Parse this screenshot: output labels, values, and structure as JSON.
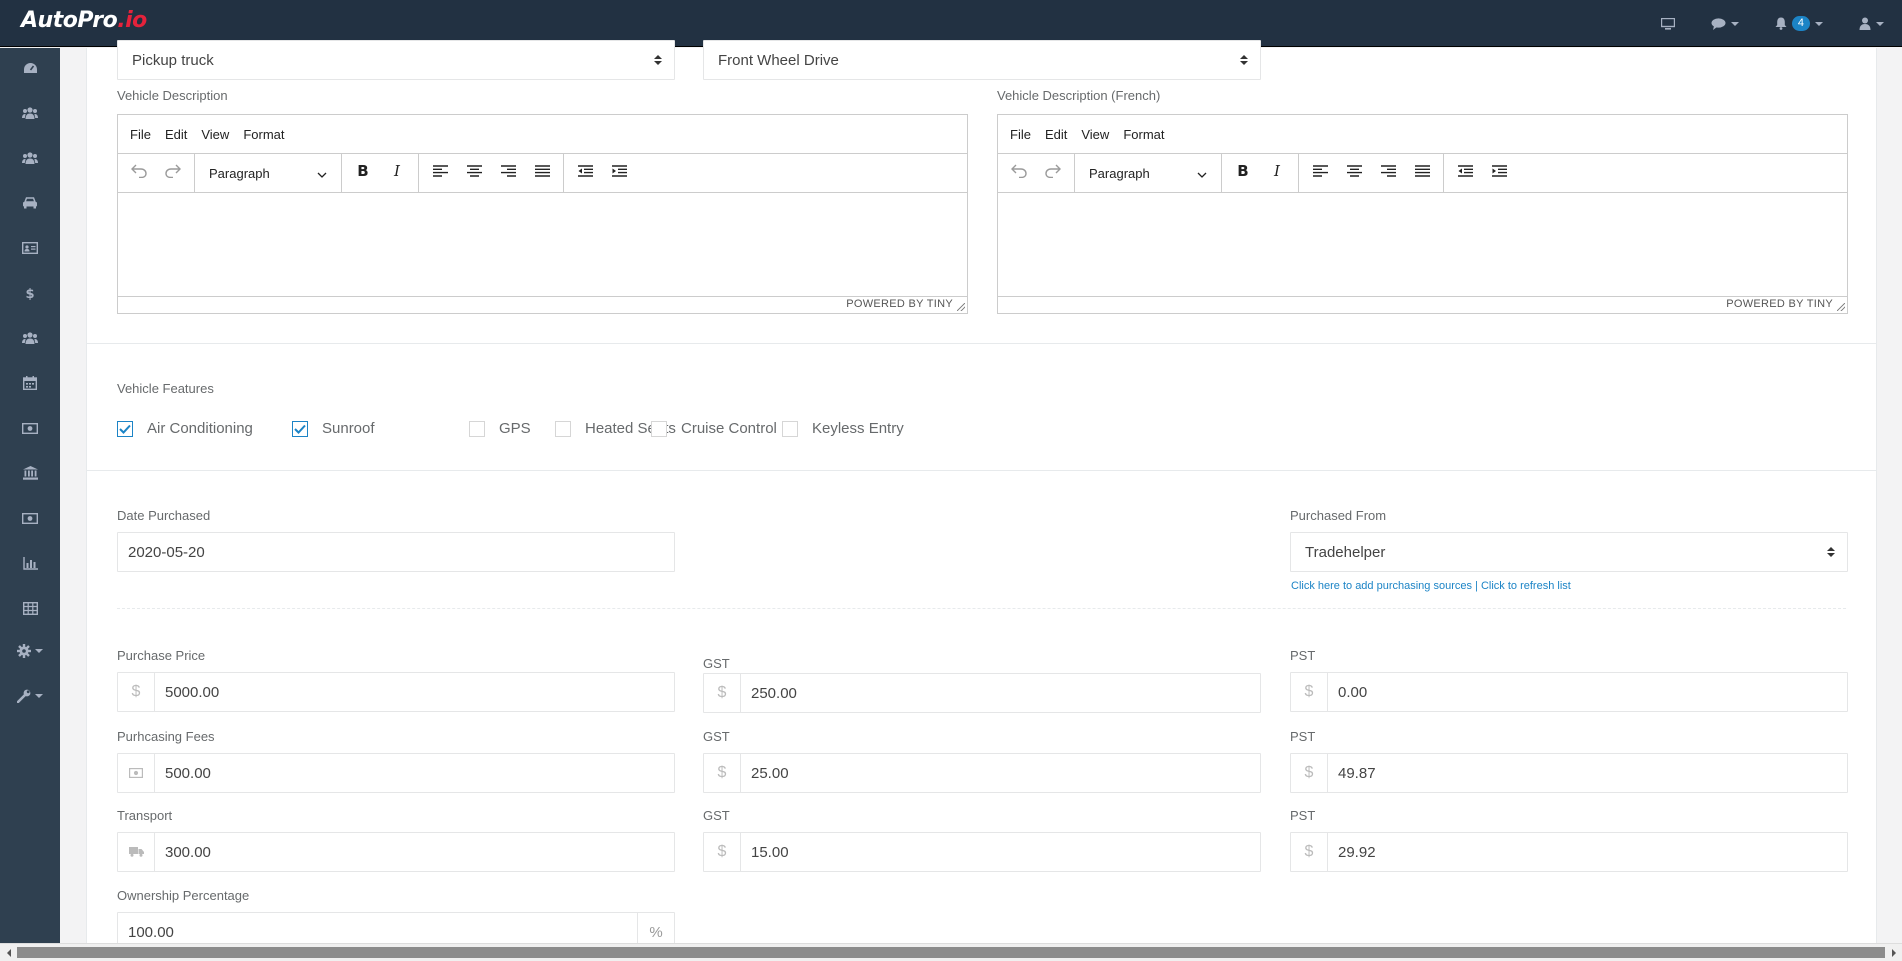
{
  "app": {
    "logo_main": "AutoPro",
    "logo_accent": ".io",
    "notifications_count": "4"
  },
  "nav_icons": [
    "monitor-icon",
    "chat-icon",
    "bell-icon",
    "user-icon"
  ],
  "sidebar_icons": [
    "dashboard-icon",
    "users-icon",
    "groups-icon",
    "car-icon",
    "id-card-icon",
    "dollar-icon",
    "team-icon",
    "calendar-icon",
    "money-icon",
    "bank-icon",
    "cash-icon",
    "bar-chart-icon",
    "table-icon",
    "gear-icon",
    "wrench-icon"
  ],
  "top_selects": {
    "body_type": "Pickup truck",
    "drive_type": "Front Wheel Drive"
  },
  "editors": {
    "desc_label": "Vehicle Description",
    "desc_fr_label": "Vehicle Description (French)",
    "menu": [
      "File",
      "Edit",
      "View",
      "Format"
    ],
    "block_format": "Paragraph",
    "powered_by": "POWERED BY TINY"
  },
  "features": {
    "label": "Vehicle Features",
    "items": [
      {
        "label": "Air Conditioning",
        "checked": true
      },
      {
        "label": "Sunroof",
        "checked": true
      },
      {
        "label": "GPS",
        "checked": false
      },
      {
        "label": "Heated Seats",
        "checked": false
      },
      {
        "label": "Cruise Control",
        "checked": false
      },
      {
        "label": "Keyless Entry",
        "checked": false
      }
    ]
  },
  "purchase": {
    "date_label": "Date Purchased",
    "date_value": "2020-05-20",
    "from_label": "Purchased From",
    "from_value": "Tradehelper",
    "add_sources_link": "Click here to add purchasing sources",
    "separator": "|",
    "refresh_link": "Click to refresh list"
  },
  "costs": {
    "price_label": "Purchase Price",
    "price_value": "5000.00",
    "price_gst_label": "GST",
    "price_gst_value": "250.00",
    "price_pst_label": "PST",
    "price_pst_value": "0.00",
    "fees_label": "Purhcasing Fees",
    "fees_value": "500.00",
    "fees_gst_label": "GST",
    "fees_gst_value": "25.00",
    "fees_pst_label": "PST",
    "fees_pst_value": "49.87",
    "transport_label": "Transport",
    "transport_value": "300.00",
    "transport_gst_label": "GST",
    "transport_gst_value": "15.00",
    "transport_pst_label": "PST",
    "transport_pst_value": "29.92",
    "ownership_label": "Ownership Percentage",
    "ownership_value": "100.00",
    "currency_symbol": "$",
    "percent_symbol": "%"
  },
  "colors": {
    "topbar": "#223142",
    "sidebar": "#2f4050",
    "accent": "#1c84c6",
    "logo_accent": "#e5223b"
  }
}
